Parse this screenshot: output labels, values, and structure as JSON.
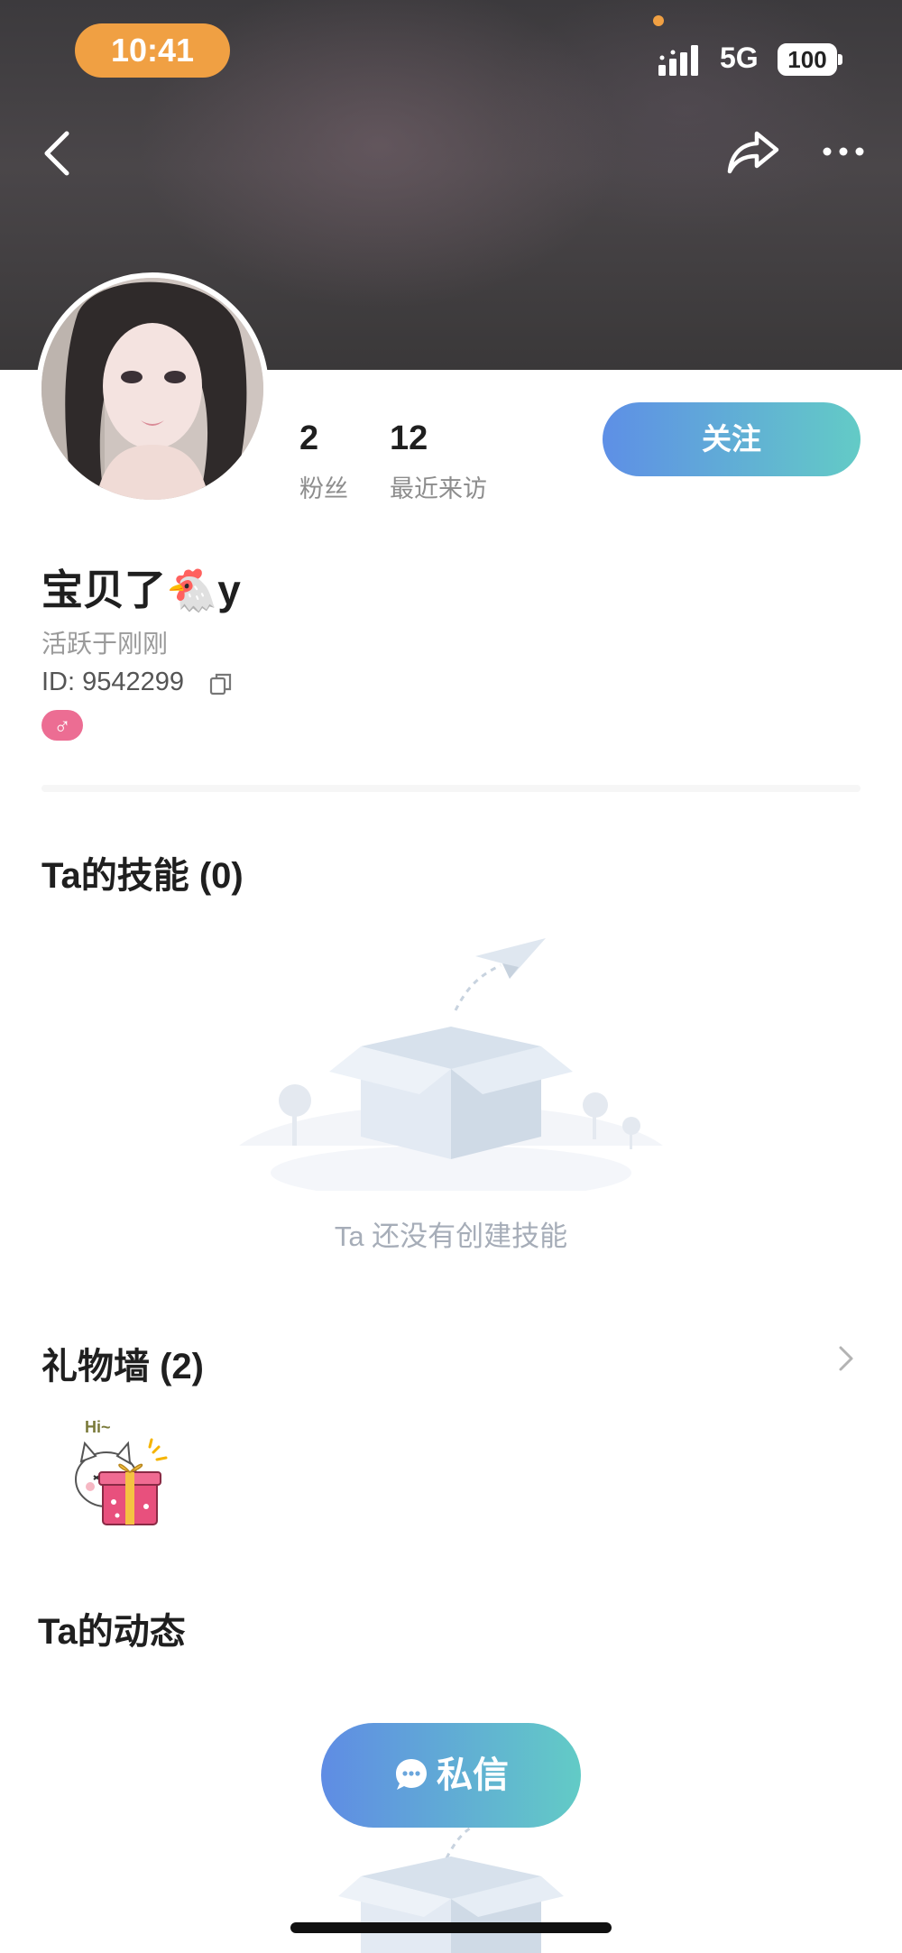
{
  "status_bar": {
    "time": "10:41",
    "network": "5G",
    "battery": "100"
  },
  "profile": {
    "username": "宝贝了🐔y",
    "active_status": "活跃于刚刚",
    "id_text": "ID: 9542299",
    "gender_symbol": "♂",
    "stats": [
      {
        "value": "2",
        "label": "粉丝"
      },
      {
        "value": "12",
        "label": "最近来访"
      }
    ],
    "follow_label": "关注"
  },
  "skills": {
    "title": "Ta的技能 (0)",
    "empty_text": "Ta 还没有创建技能"
  },
  "gift_wall": {
    "title": "礼物墙 (2)",
    "sticker_text": "Hi~"
  },
  "dynamics": {
    "title": "Ta的动态"
  },
  "message_button": {
    "label": "私信"
  },
  "colors": {
    "accent_gradient_start": "#5e8fe6",
    "accent_gradient_end": "#63cbc6",
    "time_pill": "#f0a043",
    "gender_badge": "#ec6d93"
  },
  "icons": {
    "back": "chevron-left-icon",
    "share": "share-arrow-icon",
    "more": "more-dots-icon",
    "copy": "copy-icon",
    "gift_wall_more": "chevron-right-icon",
    "message": "chat-bubble-icon"
  }
}
